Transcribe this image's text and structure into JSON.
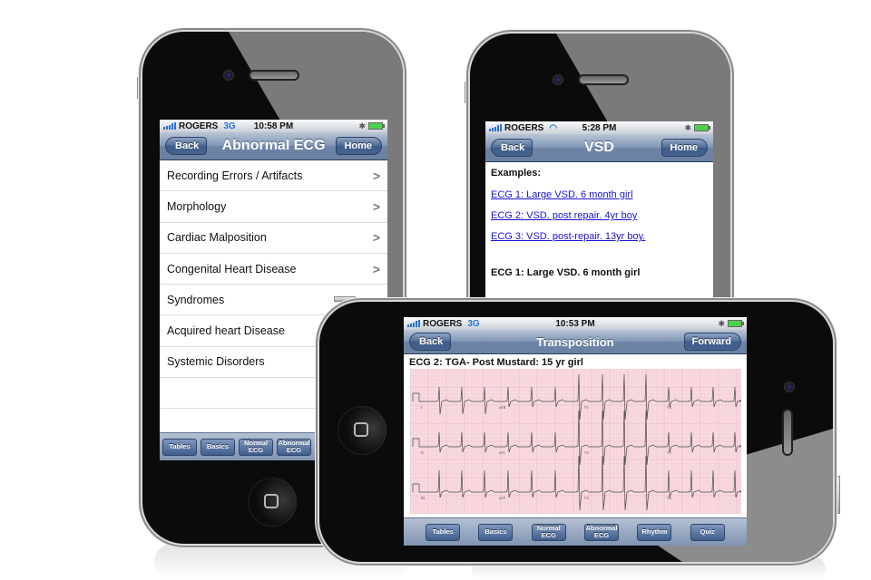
{
  "phone_left": {
    "status": {
      "carrier": "ROGERS",
      "network": "3G",
      "time": "10:58 PM",
      "bluetooth_icon": "bluetooth-icon",
      "battery_icon": "battery-icon"
    },
    "navbar": {
      "back_label": "Back",
      "title": "Abnormal ECG",
      "home_label": "Home"
    },
    "list": [
      {
        "label": "Recording Errors / Artifacts",
        "chevron": ">"
      },
      {
        "label": "Morphology",
        "chevron": ">"
      },
      {
        "label": "Cardiac Malposition",
        "chevron": ">"
      },
      {
        "label": "Congenital Heart Disease",
        "chevron": ">"
      },
      {
        "label": "Syndromes",
        "chevron": ""
      },
      {
        "label": "Acquired heart Disease",
        "chevron": ""
      },
      {
        "label": "Systemic Disorders",
        "chevron": ""
      }
    ],
    "tabbar": [
      "Tables",
      "Basics",
      "Normal ECG",
      "Abnormal ECG"
    ]
  },
  "phone_right": {
    "status": {
      "carrier": "ROGERS",
      "network": "wifi",
      "time": "5:28 PM"
    },
    "navbar": {
      "back_label": "Back",
      "title": "VSD",
      "home_label": "Home"
    },
    "content": {
      "heading": "Examples:",
      "links": [
        "ECG 1: Large VSD. 6 month girl",
        "ECG 2: VSD. post repair. 4yr boy",
        "ECG 3: VSD. post-repair. 13yr boy."
      ],
      "section_heading": "ECG 1: Large VSD. 6 month girl"
    }
  },
  "phone_landscape": {
    "status": {
      "carrier": "ROGERS",
      "network": "3G",
      "time": "10:53 PM"
    },
    "navbar": {
      "back_label": "Back",
      "title": "Transposition",
      "forward_label": "Forward"
    },
    "caption": "ECG 2: TGA- Post Mustard: 15 yr girl",
    "ecg_leads": [
      "I",
      "aVR",
      "V1",
      "V4",
      "II",
      "aVL",
      "V2",
      "V5",
      "III",
      "aVF",
      "V3",
      "V6"
    ],
    "tabbar": [
      "Tables",
      "Basics",
      "Normal ECG",
      "Abnormal ECG",
      "Rhythm",
      "Quiz"
    ]
  },
  "colors": {
    "link": "#1a12d6",
    "nav_blue": "#6d84a6",
    "ecg_paper": "#f7dbe0",
    "ecg_grid": "#eeb2bd",
    "ecg_trace": "#4a4a4a"
  }
}
